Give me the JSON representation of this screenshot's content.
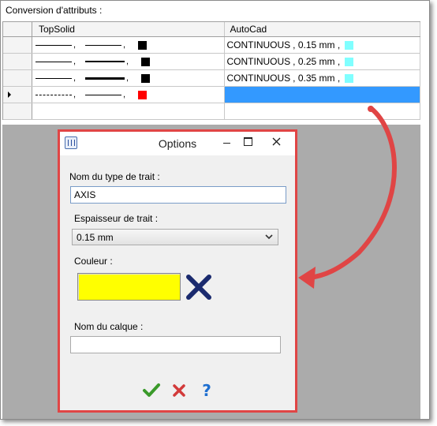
{
  "section_title": "Conversion d'attributs :",
  "grid": {
    "headers": {
      "topsolid": "TopSolid",
      "autocad": "AutoCad"
    },
    "rows": [
      {
        "ts_sep1": ",",
        "ts_sep2": ",",
        "ts_color": "#000000",
        "ac_linetype": "CONTINUOUS",
        "ac_thickness": ", 0.15 mm ,",
        "ac_color": "#80ffff"
      },
      {
        "ts_sep1": ",",
        "ts_sep2": ",",
        "ts_color": "#000000",
        "ac_linetype": "CONTINUOUS",
        "ac_thickness": ", 0.25 mm ,",
        "ac_color": "#80ffff"
      },
      {
        "ts_sep1": ",",
        "ts_sep2": ",",
        "ts_color": "#000000",
        "ac_linetype": "CONTINUOUS",
        "ac_thickness": ", 0.35 mm ,",
        "ac_color": "#80ffff"
      },
      {
        "ts_sep1": ",",
        "ts_sep2": ",",
        "ts_color": "#ff0000",
        "ac_linetype": "",
        "ac_thickness": "",
        "ac_color": ""
      }
    ]
  },
  "dialog": {
    "title": "Options",
    "linetype_label": "Nom du type de trait :",
    "linetype_value": "AXIS",
    "thickness_label": "Espaisseur de trait :",
    "thickness_selected": "0.15 mm",
    "color_label": "Couleur :",
    "color_value": "#ffff00",
    "layer_label": "Nom du calque :",
    "layer_value": ""
  },
  "colors": {
    "selection": "#3399ff",
    "highlight_border": "#e04545",
    "annotation_arrow": "#e04545"
  },
  "icons": {
    "dialog": "options-dialog-icon",
    "clear_color": "clear-color-x-icon",
    "ok": "ok-checkmark-icon",
    "cancel": "cancel-x-icon",
    "help": "help-question-icon"
  }
}
